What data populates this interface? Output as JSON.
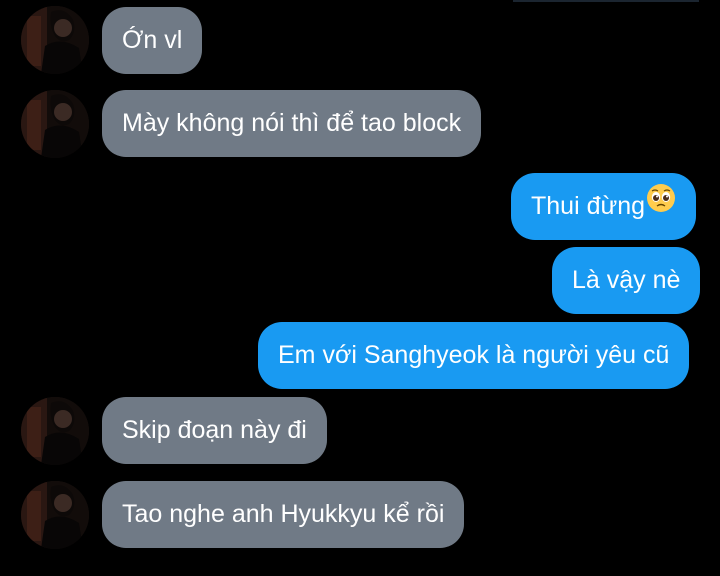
{
  "contact": {
    "avatar_icon": "avatar-photo"
  },
  "messages": [
    {
      "direction": "received",
      "text": "Ớn vl"
    },
    {
      "direction": "received",
      "text": "Mày không nói thì để tao block"
    },
    {
      "direction": "sent",
      "text": "Thui đừng",
      "emoji": "pleading-face-icon"
    },
    {
      "direction": "sent",
      "text": "Là vậy nè"
    },
    {
      "direction": "sent",
      "text": "Em với Sanghyeok là người yêu cũ"
    },
    {
      "direction": "received",
      "text": "Skip đoạn này đi"
    },
    {
      "direction": "received",
      "text": "Tao nghe anh Hyukkyu kể rồi"
    }
  ],
  "colors": {
    "background": "#000000",
    "received_bubble": "#707a86",
    "sent_bubble": "#199af2",
    "text": "#ffffff"
  }
}
